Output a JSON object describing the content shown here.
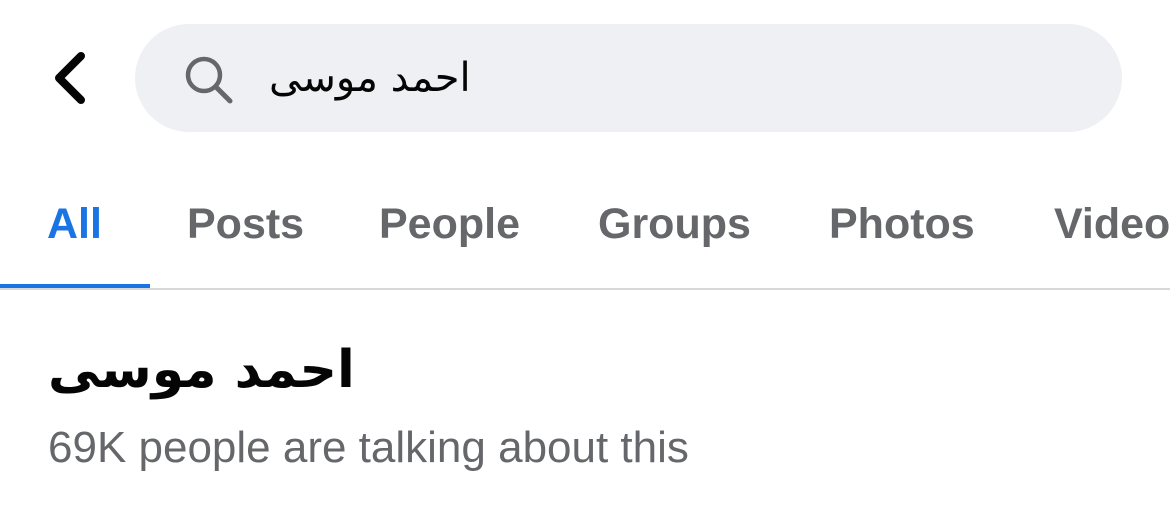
{
  "search": {
    "query": "احمد موسی",
    "icon": "search-icon",
    "back_icon": "chevron-left-icon"
  },
  "tabs": [
    {
      "label": "All",
      "active": true
    },
    {
      "label": "Posts",
      "active": false
    },
    {
      "label": "People",
      "active": false
    },
    {
      "label": "Groups",
      "active": false
    },
    {
      "label": "Photos",
      "active": false
    },
    {
      "label": "Videos",
      "active": false
    }
  ],
  "result": {
    "title": "احمد موسی",
    "subtitle": "69K people are talking about this"
  },
  "colors": {
    "accent": "#1b74e4",
    "muted_text": "#65676b",
    "search_bg": "#eff0f4",
    "divider": "#d6d8dc"
  }
}
